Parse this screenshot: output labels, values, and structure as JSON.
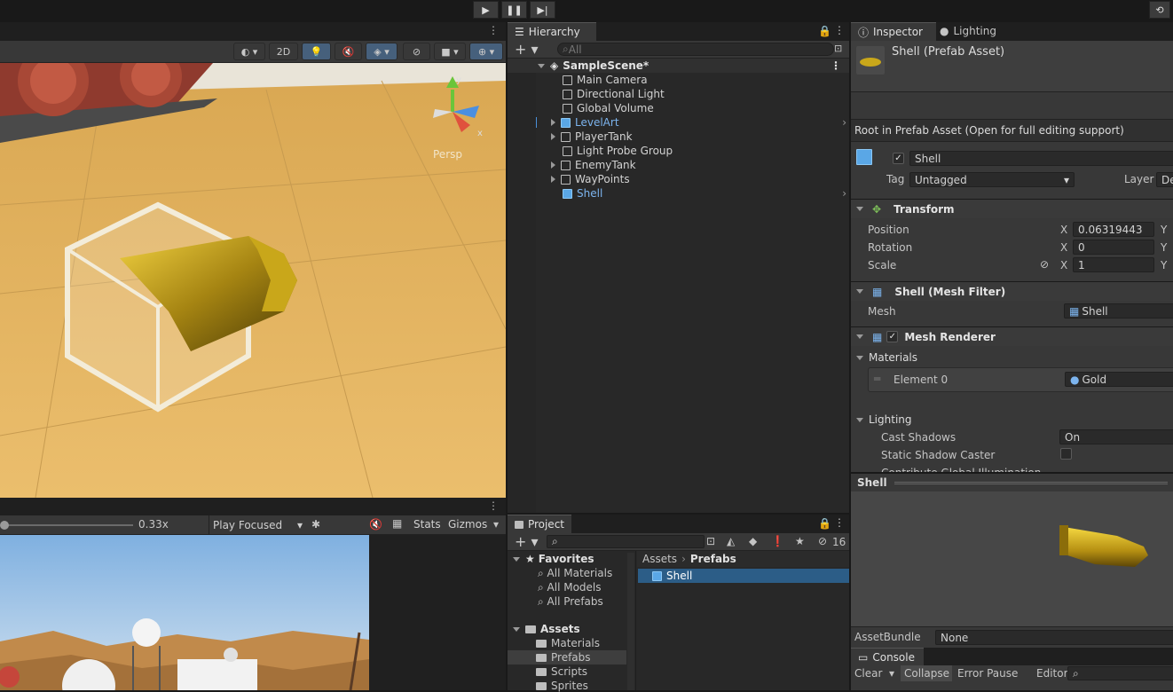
{
  "toolbar": {
    "play_label": "▶",
    "pause_label": "❚❚",
    "step_label": "▶|",
    "history_label": "⟲"
  },
  "scene_view": {
    "btn_2d": "2D",
    "persp_label": "Persp",
    "gizmo_x": "x",
    "gizmo_y": "y"
  },
  "game_view": {
    "zoom": "0.33x",
    "play_mode": "Play Focused",
    "stats": "Stats",
    "gizmos": "Gizmos"
  },
  "hierarchy": {
    "tab": "Hierarchy",
    "search_placeholder": "All",
    "scene_name": "SampleScene*",
    "items": [
      "Main Camera",
      "Directional Light",
      "Global Volume",
      "LevelArt",
      "PlayerTank",
      "Light Probe Group",
      "EnemyTank",
      "WayPoints",
      "Shell"
    ]
  },
  "inspector": {
    "tab_inspector": "Inspector",
    "tab_lighting": "Lighting",
    "asset_title": "Shell (Prefab Asset)",
    "root_notice": "Root in Prefab Asset (Open for full editing support)",
    "object_name": "Shell",
    "tag_label": "Tag",
    "tag_value": "Untagged",
    "layer_label": "Layer",
    "layer_value": "De",
    "transform": {
      "title": "Transform",
      "position_label": "Position",
      "position_x": "0.06319443",
      "rotation_label": "Rotation",
      "rotation_x": "0",
      "scale_label": "Scale",
      "scale_x": "1",
      "x": "X",
      "y": "Y"
    },
    "mesh_filter": {
      "title": "Shell (Mesh Filter)",
      "mesh_label": "Mesh",
      "mesh_value": "Shell"
    },
    "mesh_renderer": {
      "title": "Mesh Renderer",
      "materials_label": "Materials",
      "element0_label": "Element 0",
      "element0_value": "Gold",
      "lighting_label": "Lighting",
      "cast_shadows_label": "Cast Shadows",
      "cast_shadows_value": "On",
      "static_caster_label": "Static Shadow Caster",
      "contribute_gi_label": "Contribute Global Illumination"
    },
    "preview_title": "Shell",
    "assetbundle_label": "AssetBundle",
    "assetbundle_value": "None"
  },
  "console": {
    "tab": "Console",
    "clear": "Clear",
    "collapse": "Collapse",
    "error_pause": "Error Pause",
    "editor": "Editor"
  },
  "project": {
    "tab": "Project",
    "hidden_count": "16",
    "favorites_label": "Favorites",
    "favorites": [
      "All Materials",
      "All Models",
      "All Prefabs"
    ],
    "assets_label": "Assets",
    "folders": [
      "Materials",
      "Prefabs",
      "Scripts",
      "Sprites"
    ],
    "breadcrumb_root": "Assets",
    "breadcrumb_current": "Prefabs",
    "selected_asset": "Shell"
  },
  "colors": {
    "selection": "#2c5d87",
    "accent_blue": "#7cb4ee",
    "panel": "#282828",
    "header": "#383838"
  }
}
